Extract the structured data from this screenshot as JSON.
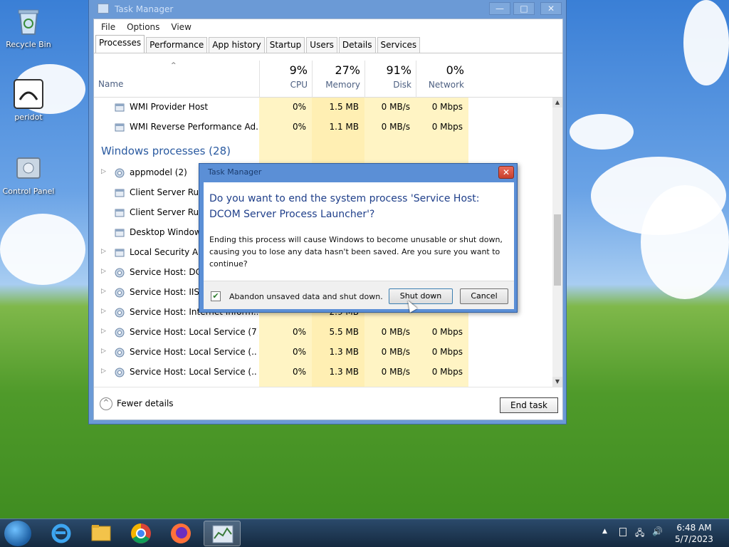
{
  "desktop": {
    "icons": [
      {
        "label": "Recycle Bin"
      },
      {
        "label": "peridot"
      },
      {
        "label": "Control Panel"
      }
    ]
  },
  "task_manager": {
    "window_title": "Task Manager",
    "menu": [
      "File",
      "Options",
      "View"
    ],
    "tabs": [
      "Processes",
      "Performance",
      "App history",
      "Startup",
      "Users",
      "Details",
      "Services"
    ],
    "active_tab": "Processes",
    "columns": {
      "name": "Name",
      "cpu": {
        "pct": "9%",
        "label": "CPU"
      },
      "memory": {
        "pct": "27%",
        "label": "Memory"
      },
      "disk": {
        "pct": "91%",
        "label": "Disk"
      },
      "network": {
        "pct": "0%",
        "label": "Network"
      }
    },
    "rows_top": [
      {
        "name": "WMI Provider Host",
        "cpu": "0%",
        "memory": "1.5 MB",
        "disk": "0 MB/s",
        "network": "0 Mbps"
      },
      {
        "name": "WMI Reverse Performance Ad...",
        "cpu": "0%",
        "memory": "1.1 MB",
        "disk": "0 MB/s",
        "network": "0 Mbps"
      }
    ],
    "group_title": "Windows processes (28)",
    "rows_windows": [
      {
        "name": "appmodel (2)",
        "cpu": "",
        "memory": "",
        "disk": "",
        "network": ""
      },
      {
        "name": "Client Server Runt",
        "cpu": "",
        "memory": "",
        "disk": "",
        "network": ""
      },
      {
        "name": "Client Server Runt",
        "cpu": "",
        "memory": "",
        "disk": "",
        "network": ""
      },
      {
        "name": "Desktop Window M",
        "cpu": "",
        "memory": "",
        "disk": "",
        "network": ""
      },
      {
        "name": "Local Security Au",
        "cpu": "",
        "memory": "",
        "disk": "",
        "network": ""
      },
      {
        "name": "Service Host: DC",
        "cpu": "",
        "memory": "",
        "disk": "",
        "network": ""
      },
      {
        "name": "Service Host: IIS",
        "cpu": "",
        "memory": "",
        "disk": "",
        "network": ""
      },
      {
        "name": "Service Host: Internet Inform...",
        "cpu": "",
        "memory": "2.9 MB",
        "disk": "",
        "network": ""
      },
      {
        "name": "Service Host: Local Service (7)",
        "cpu": "0%",
        "memory": "5.5 MB",
        "disk": "0 MB/s",
        "network": "0 Mbps"
      },
      {
        "name": "Service Host: Local Service (...",
        "cpu": "0%",
        "memory": "1.3 MB",
        "disk": "0 MB/s",
        "network": "0 Mbps"
      },
      {
        "name": "Service Host: Local Service (...",
        "cpu": "0%",
        "memory": "1.3 MB",
        "disk": "0 MB/s",
        "network": "0 Mbps"
      }
    ],
    "fewer_details": "Fewer details",
    "end_task": "End task"
  },
  "dialog": {
    "title": "Task Manager",
    "question": "Do you want to end the system process 'Service Host: DCOM Server Process Launcher'?",
    "message": "Ending this process will cause Windows to become unusable or shut down, causing you to lose any data hasn't been saved. Are you sure you want to continue?",
    "checkbox_label": "Abandon unsaved data and shut down.",
    "checkbox_checked": true,
    "shutdown_label": "Shut down",
    "cancel_label": "Cancel"
  },
  "taskbar": {
    "time": "6:48 AM",
    "date": "5/7/2023"
  },
  "colors": {
    "accent": "#2a5aa0",
    "cell_highlight": "#fff4c4",
    "disk_highlight": "#ffe9a3"
  }
}
